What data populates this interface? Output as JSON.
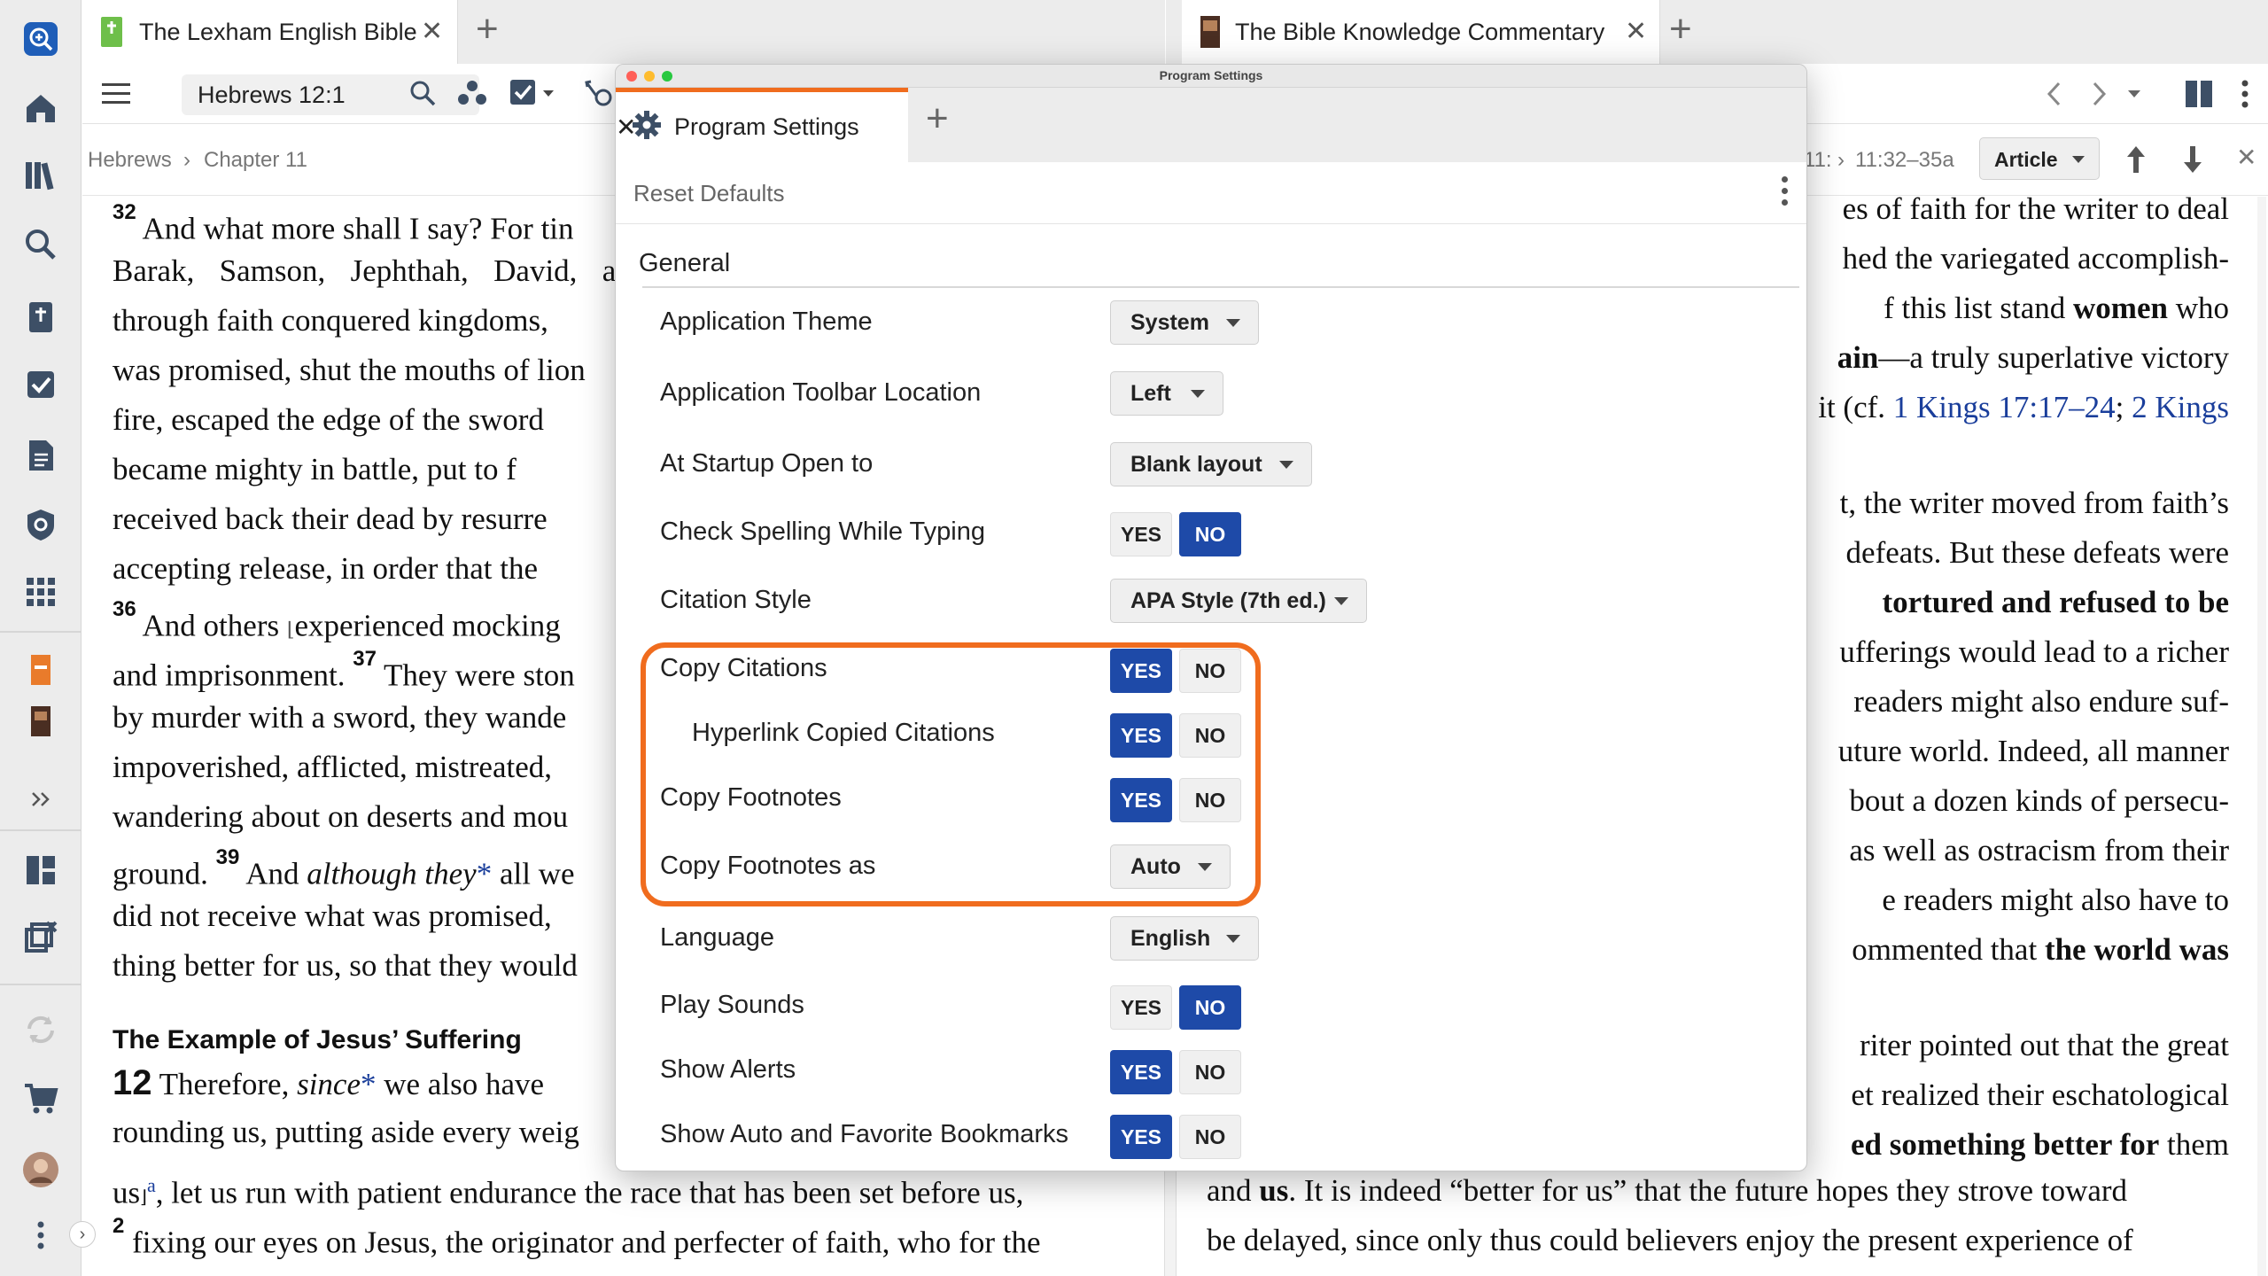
{
  "left_tab": {
    "title": "The Lexham English Bible"
  },
  "right_tab": {
    "title": "The Bible Knowledge Commentary"
  },
  "left_toolbar": {
    "reference": "Hebrews 12:1"
  },
  "left_breadcrumb": {
    "book": "Hebrews",
    "sep": "›",
    "chapter": "Chapter 11"
  },
  "right_breadcrumb": {
    "ref_a": "11:",
    "sep": "›",
    "ref_b": "11:32–35a",
    "view": "Article"
  },
  "bible_text": {
    "l1_num": "32",
    "l1": "And what more shall I say? For tin",
    "l2a": "Barak,",
    "l2b": "Samson,",
    "l2c": "Jephthah,",
    "l2d": "David,",
    "l2e": "ar",
    "l3": "through faith conquered kingdoms,",
    "l4": "was promised, shut the mouths of lion",
    "l5": "fire, escaped the edge of the sword",
    "l6": "became mighty in battle, put to f",
    "l7": "received back their dead by resurre",
    "l8": "accepting release, in order that the",
    "l9_num": "36",
    "l9": "And others",
    "l9b": "experienced mocking",
    "l10": "and imprisonment.",
    "l10_num": "37",
    "l10b": "They were ston",
    "l11": "by murder with a sword, they wande",
    "l12": "impoverished, afflicted, mistreated,",
    "l13": "wandering about on deserts and mou",
    "l14a": "ground.",
    "l14_num": "39",
    "l14b": "And",
    "l14c": "although they",
    "l14d": "*",
    "l14e": "all we",
    "l15": "did not receive what was promised,",
    "l16": "thing better for us, so that they would",
    "heading": "The Example of Jesus’ Suffering",
    "l17_num": "12",
    "l17a": "Therefore,",
    "l17b": "since",
    "l17c": "*",
    "l17d": "we also have",
    "l18": "rounding us, putting aside every weig",
    "l19a": "us",
    "l19sup": "a",
    "l19b": ", let us run with patient endurance the race that has been set before us,",
    "l20_num": "2",
    "l20": "fixing our eyes on Jesus, the originator and perfecter of faith, who for the"
  },
  "commentary_text": {
    "r1": "es of faith for the writer to deal",
    "r2": "hed the variegated accomplish-",
    "r3a": "f this list stand",
    "r3b": "women",
    "r3c": "who",
    "r4a": "ain",
    "r4b": "—a truly superlative victory",
    "r5a": "it (cf.",
    "r5b": "1 Kings 17:17–24",
    "r5c": ";",
    "r5d": "2 Kings",
    "r6": "t, the writer moved from faith’s",
    "r7": "defeats. But these defeats were",
    "r8": "tortured and refused to be",
    "r9": "ufferings would lead to a richer",
    "r10": "readers might also endure suf-",
    "r11": "uture world. Indeed, all manner",
    "r12": "bout a dozen kinds of persecu-",
    "r13": "as well as ostracism from their",
    "r14": "e readers might also have to",
    "r15a": "ommented that",
    "r15b": "the world was",
    "r16": "riter pointed out that the great",
    "r17": "et realized their eschatological",
    "r18a": "ed something better for",
    "r18b": "them",
    "r19a": "and",
    "r19b": "us",
    "r19c": ". It is indeed “better for us” that the future hopes they strove toward",
    "r20": "be delayed, since only thus could believers enjoy the present experience of"
  },
  "dialog": {
    "window_title": "Program Settings",
    "tab_title": "Program Settings",
    "reset_label": "Reset Defaults",
    "section": "General",
    "yes": "YES",
    "no": "NO",
    "settings": {
      "theme": {
        "label": "Application Theme",
        "value": "System"
      },
      "toolbar_location": {
        "label": "Application Toolbar Location",
        "value": "Left"
      },
      "startup": {
        "label": "At Startup Open to",
        "value": "Blank layout"
      },
      "spelling": {
        "label": "Check Spelling While Typing",
        "state": "NO"
      },
      "citation_style": {
        "label": "Citation Style",
        "value": "APA Style (7th ed.)"
      },
      "copy_citations": {
        "label": "Copy Citations",
        "state": "YES"
      },
      "hyperlink_citations": {
        "label": "Hyperlink Copied Citations",
        "state": "YES"
      },
      "copy_footnotes": {
        "label": "Copy Footnotes",
        "state": "YES"
      },
      "footnotes_as": {
        "label": "Copy Footnotes as",
        "value": "Auto"
      },
      "language": {
        "label": "Language",
        "value": "English"
      },
      "play_sounds": {
        "label": "Play Sounds",
        "state": "NO"
      },
      "show_alerts": {
        "label": "Show Alerts",
        "state": "YES"
      },
      "bookmarks": {
        "label": "Show Auto and Favorite Bookmarks",
        "state": "YES"
      }
    }
  },
  "colors": {
    "accent_orange": "#f06c1e",
    "toggle_blue": "#1e4aa8",
    "link_blue": "#1a3e9b",
    "brand_blue": "#1f5eb8"
  }
}
